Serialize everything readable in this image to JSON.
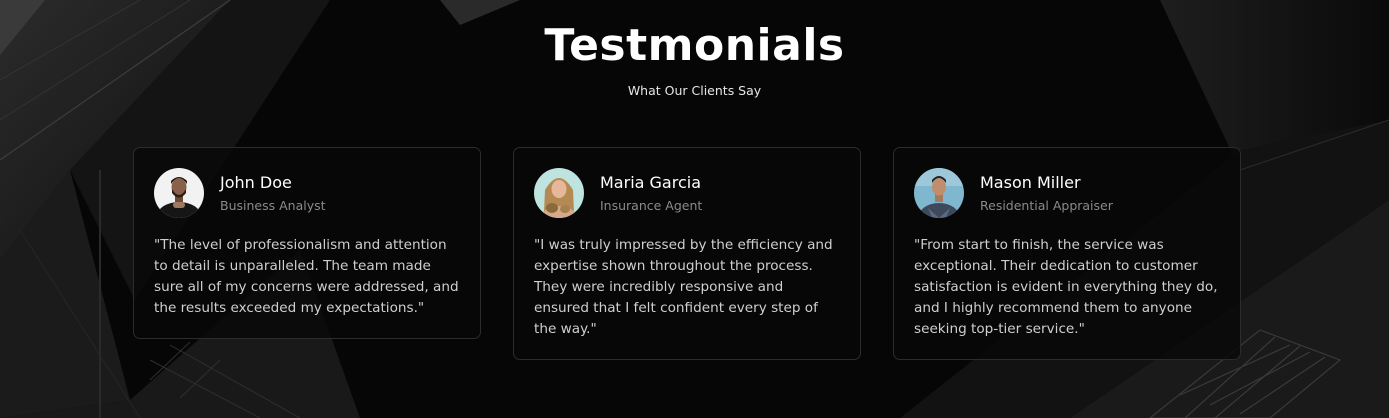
{
  "header": {
    "title": "Testmonials",
    "subtitle": "What Our Clients Say"
  },
  "testimonials": [
    {
      "name": "John Doe",
      "role": "Business Analyst",
      "avatar": "avatar-photo-man-beard",
      "quote": "\"The level of professionalism and attention to detail is unparalleled. The team made sure all of my concerns were addressed, and the results exceeded my expectations.\""
    },
    {
      "name": "Maria Garcia",
      "role": "Insurance Agent",
      "avatar": "avatar-photo-woman-blonde",
      "quote": "\"I was truly impressed by the efficiency and expertise shown throughout the process. They were incredibly responsive and ensured that I felt confident every step of the way.\""
    },
    {
      "name": "Mason Miller",
      "role": "Residential Appraiser",
      "avatar": "avatar-photo-man-plaid",
      "quote": "\"From start to finish, the service was exceptional. Their dedication to customer satisfaction is evident in everything they do, and I highly recommend them to anyone seeking top-tier service.\""
    }
  ],
  "colors": {
    "background": "#060606",
    "text_primary": "#ffffff",
    "text_secondary": "#8a8a8a",
    "card_border": "#2c2c2c"
  }
}
